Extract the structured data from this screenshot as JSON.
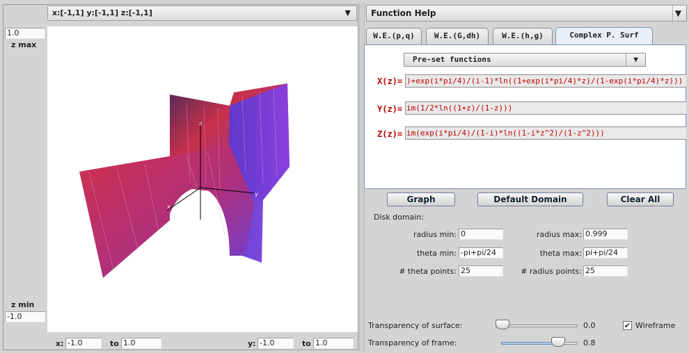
{
  "plot": {
    "domain_label": "x:[-1,1] y:[-1,1] z:[-1,1]",
    "zmax_value": "1.0",
    "zmax_label": "z max",
    "zmin_label": "z min",
    "zmin_value": "-1.0",
    "x_label": "x:",
    "x_from": "-1.0",
    "x_to_label": "to",
    "x_to": "1.0",
    "y_label": "y:",
    "y_from": "-1.0",
    "y_to_label": "to",
    "y_to": "1.0",
    "surface_colors": {
      "front": "#c8304a",
      "side": "#6a3fd8",
      "edge": "#3a2b7a"
    }
  },
  "help": {
    "combo_label": "Function Help"
  },
  "tabs": [
    {
      "label": "W.E.(p,q)"
    },
    {
      "label": "W.E.(G,dh)"
    },
    {
      "label": "W.E.(h,g)"
    },
    {
      "label": "Complex P. Surf"
    }
  ],
  "editor": {
    "preset_label": "Pre-set functions",
    "x_label": "X(z)=",
    "x_value": ")+exp(i*pi/4)/(i-1)*ln((1+exp(i*pi/4)*z)/(1-exp(i*pi/4)*z)))",
    "y_label": "Y(z)=",
    "y_value": "im(1/2*ln((1+z)/(1-z)))",
    "z_label": "Z(z)=",
    "z_value": "im(exp(i*pi/4)/(1-i)*ln((1-i*z^2)/(1-z^2)))"
  },
  "buttons": {
    "graph": "Graph",
    "default_domain": "Default Domain",
    "clear_all": "Clear All"
  },
  "domain": {
    "title": "Disk domain:",
    "radius_min_label": "radius min:",
    "radius_min": "0",
    "radius_max_label": "radius max:",
    "radius_max": "0.999",
    "theta_min_label": "theta min:",
    "theta_min": "-pi+pi/24",
    "theta_max_label": "theta max:",
    "theta_max": "pi+pi/24",
    "theta_points_label": "# theta points:",
    "theta_points": "25",
    "radius_points_label": "# radius points:",
    "radius_points": "25"
  },
  "transparency": {
    "surface_label": "Transparency of surface:",
    "surface_value": "0.0",
    "surface_fraction": 0.0,
    "frame_label": "Transparency of frame:",
    "frame_value": "0.8",
    "frame_fraction": 0.8,
    "wireframe_label": "Wireframe",
    "wireframe_checked": true
  }
}
